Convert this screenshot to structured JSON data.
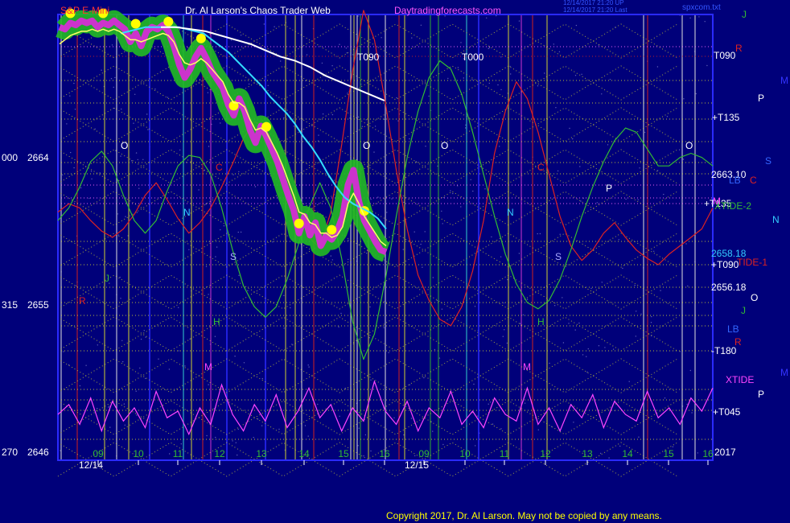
{
  "header": {
    "instrument": "S&P E-Mini",
    "author": "Dr. Al Larson's Chaos Trader Web",
    "site": "Daytradingforecasts.com",
    "stamp_line1": "12/14/2017 21:20 UP",
    "stamp_line2": "12/14/2017 21:20 Last",
    "file": "spxcom.txt"
  },
  "footer": {
    "copyright": "Copyright 2017, Dr. Al Larson. May not be copied by any means."
  },
  "colors": {
    "background": "#00007a",
    "plot_border": "#2a2aff",
    "price_bar_body": "#cc33cc",
    "price_bar_glow": "#22bb22",
    "marker_yellow": "#ffff00",
    "avg_yellow": "#ffff66",
    "avg_cyan": "#33ddff",
    "avg_white": "#ffffff",
    "red_line": "#dd2222",
    "green_line": "#33bb33",
    "magenta_line": "#ff44ff",
    "dotted_yellow": "#cccc33",
    "dotted_pink": "#ff66ff",
    "vline_red": "#cc2222",
    "vline_white": "#dddddd",
    "vline_cyan": "#33cccc",
    "vline_yellow": "#cccc33",
    "vline_magenta": "#cc33cc",
    "vline_green": "#33aa33"
  },
  "chart_data": {
    "type": "line",
    "title": "S&P E-Mini",
    "left_axis_labels": [
      {
        "value": 2664,
        "prefix": "000",
        "label": "2664"
      },
      {
        "value": 2655,
        "prefix": "315",
        "label": "2655"
      },
      {
        "value": 2646,
        "prefix": "270",
        "label": "2646"
      }
    ],
    "x_tick_labels": [
      "09",
      "10",
      "11",
      "12",
      "13",
      "14",
      "15",
      "16",
      "09",
      "10",
      "11",
      "12",
      "13",
      "14",
      "15",
      "16"
    ],
    "date_labels": [
      "12/14",
      "12/15"
    ],
    "right_axis_labels": [
      {
        "text": "T090",
        "color": "#ffffff"
      },
      {
        "text": "+T135",
        "color": "#ffffff"
      },
      {
        "text": "2663.10",
        "color": "#ffffff"
      },
      {
        "text": "+T135",
        "color": "#ffffff"
      },
      {
        "text": "2658.18",
        "color": "#33ccff"
      },
      {
        "text": "+T090",
        "color": "#ffffff"
      },
      {
        "text": "2656.18",
        "color": "#ffffff"
      },
      {
        "text": "-T180",
        "color": "#ffffff"
      },
      {
        "text": "+T045",
        "color": "#ffffff"
      },
      {
        "text": "2017",
        "color": "#ffffff"
      }
    ],
    "side_letters": [
      {
        "text": "J",
        "color": "#33bb33"
      },
      {
        "text": "R",
        "color": "#dd2222"
      },
      {
        "text": "M",
        "color": "#3333ff"
      },
      {
        "text": "P",
        "color": "#ffffff"
      },
      {
        "text": "S",
        "color": "#3366ff"
      },
      {
        "text": "LB",
        "color": "#3366ff"
      },
      {
        "text": "C",
        "color": "#dd2222"
      },
      {
        "text": "XTIDE-2",
        "color": "#33bb33"
      },
      {
        "text": "M",
        "color": "#ff44ff"
      },
      {
        "text": "N",
        "color": "#33ccff"
      },
      {
        "text": "TIDE-1",
        "color": "#dd2222"
      },
      {
        "text": "O",
        "color": "#ffffff"
      },
      {
        "text": "J",
        "color": "#33bb33"
      },
      {
        "text": "LB",
        "color": "#3366ff"
      },
      {
        "text": "R",
        "color": "#dd2222"
      },
      {
        "text": "M",
        "color": "#3333ff"
      },
      {
        "text": "XTIDE",
        "color": "#ff44ff"
      },
      {
        "text": "P",
        "color": "#ffffff"
      }
    ],
    "inner_labels": [
      {
        "text": "T090",
        "color": "#ffffff"
      },
      {
        "text": "T000",
        "color": "#ffffff"
      },
      {
        "text": "O",
        "color": "#ffffff"
      },
      {
        "text": "O",
        "color": "#ffffff"
      },
      {
        "text": "O",
        "color": "#ffffff"
      },
      {
        "text": "O",
        "color": "#ffffff"
      },
      {
        "text": "N",
        "color": "#33ccff"
      },
      {
        "text": "N",
        "color": "#33ccff"
      },
      {
        "text": "S",
        "color": "#aaaaff"
      },
      {
        "text": "S",
        "color": "#aaaaff"
      },
      {
        "text": "H",
        "color": "#33bb33"
      },
      {
        "text": "H",
        "color": "#33bb33"
      },
      {
        "text": "M",
        "color": "#ff44ff"
      },
      {
        "text": "M",
        "color": "#ff44ff"
      },
      {
        "text": "P",
        "color": "#ffffff"
      },
      {
        "text": "C",
        "color": "#dd2222"
      },
      {
        "text": "R",
        "color": "#dd2222"
      },
      {
        "text": "J",
        "color": "#33bb33"
      },
      {
        "text": "C",
        "color": "#dd2222"
      }
    ],
    "price_series": [
      2666.6,
      2666.5,
      2666.8,
      2666.7,
      2666.9,
      2666.8,
      2666.9,
      2666.6,
      2666.8,
      2666.7,
      2666.9,
      2666.7,
      2666.5,
      2665.9,
      2666.3,
      2665.7,
      2666.4,
      2666.6,
      2666.5,
      2666.7,
      2666.4,
      2665.7,
      2664.8,
      2664.2,
      2664.6,
      2665.2,
      2665.6,
      2665.1,
      2664.5,
      2664.1,
      2663.7,
      2662.9,
      2662.4,
      2663.2,
      2662.6,
      2661.7,
      2661.1,
      2661.9,
      2661.4,
      2660.8,
      2660.2,
      2659.4,
      2658.6,
      2657.9,
      2656.8,
      2657.6,
      2656.7,
      2657.3,
      2656.2,
      2656.7,
      2656.5,
      2656.9,
      2657.6,
      2659.1,
      2659.8,
      2658.3,
      2657.4,
      2656.9,
      2656.4,
      2656.0,
      2655.9
    ],
    "avg_yellow": [
      2665.8,
      2666.0,
      2666.2,
      2666.3,
      2666.4,
      2666.4,
      2666.5,
      2666.4,
      2666.5,
      2666.4,
      2666.5,
      2666.4,
      2666.2,
      2666.0,
      2666.0,
      2665.9,
      2666.0,
      2666.1,
      2666.2,
      2666.3,
      2666.2,
      2665.9,
      2665.3,
      2664.9,
      2664.8,
      2664.9,
      2665.1,
      2664.9,
      2664.6,
      2664.3,
      2664.0,
      2663.4,
      2663.0,
      2663.0,
      2662.8,
      2662.2,
      2661.7,
      2661.8,
      2661.6,
      2661.1,
      2660.6,
      2660.0,
      2659.3,
      2658.6,
      2657.8,
      2657.7,
      2657.3,
      2657.2,
      2656.8,
      2656.8,
      2656.6,
      2656.7,
      2657.1,
      2658.2,
      2658.7,
      2658.2,
      2657.6,
      2657.2,
      2656.8,
      2656.4,
      2656.2
    ],
    "avg_cyan": [
      2666.3,
      2666.4,
      2666.5,
      2666.6,
      2666.6,
      2666.6,
      2666.6,
      2666.6,
      2666.5,
      2666.4,
      2666.3,
      2666.0,
      2665.7,
      2665.4,
      2665.0,
      2664.6,
      2664.2,
      2663.8,
      2663.3,
      2662.9,
      2662.5,
      2662.0,
      2661.4,
      2660.9,
      2660.3,
      2659.6,
      2659.0,
      2658.5,
      2658.2,
      2658.0,
      2657.8,
      2657.5,
      2657.0
    ],
    "avg_white": [
      2666.6,
      2666.6,
      2666.5,
      2666.4,
      2666.2,
      2666.0,
      2665.8,
      2665.5,
      2665.2,
      2665.0,
      2664.7,
      2664.3,
      2664.0,
      2663.7,
      2663.4,
      2663.1
    ],
    "red_series": [
      2657.8,
      2658.2,
      2658.0,
      2657.4,
      2656.9,
      2656.6,
      2657.0,
      2657.7,
      2658.6,
      2659.2,
      2658.4,
      2657.5,
      2656.8,
      2657.3,
      2658.0,
      2659.0,
      2660.1,
      2661.3,
      2662.1,
      2661.9,
      2660.6,
      2659.2,
      2657.8,
      2656.6,
      2656.1,
      2657.8,
      2661.0,
      2664.5,
      2667.4,
      2666.0,
      2663.0,
      2659.8,
      2657.0,
      2654.8,
      2653.6,
      2652.7,
      2652.4,
      2653.3,
      2655.0,
      2657.4,
      2660.6,
      2662.6,
      2664.0,
      2663.2,
      2661.6,
      2659.6,
      2657.6,
      2656.2,
      2655.5,
      2656.0,
      2656.8,
      2657.3,
      2656.6,
      2656.0,
      2655.6,
      2655.3,
      2655.8,
      2656.2,
      2656.6,
      2657.0,
      2658.0
    ],
    "green_series": [
      2657.4,
      2658.0,
      2659.0,
      2660.2,
      2660.7,
      2660.0,
      2658.6,
      2657.4,
      2656.8,
      2657.4,
      2658.8,
      2660.0,
      2660.5,
      2660.4,
      2659.6,
      2658.0,
      2656.0,
      2654.3,
      2653.3,
      2652.8,
      2653.3,
      2654.6,
      2656.2,
      2658.0,
      2659.2,
      2658.0,
      2655.6,
      2652.6,
      2650.8,
      2652.0,
      2654.6,
      2657.6,
      2660.4,
      2662.6,
      2664.2,
      2665.0,
      2664.6,
      2663.4,
      2661.6,
      2659.6,
      2657.6,
      2655.8,
      2654.4,
      2653.5,
      2653.2,
      2653.6,
      2654.6,
      2656.0,
      2657.6,
      2659.0,
      2660.2,
      2661.2,
      2661.8,
      2661.6,
      2660.8,
      2660.0,
      2660.0,
      2660.4,
      2660.6,
      2660.4,
      2660.0
    ],
    "xtide_series": [
      0.45,
      0.6,
      0.3,
      0.7,
      0.2,
      0.65,
      0.35,
      0.55,
      0.25,
      0.8,
      0.4,
      0.5,
      0.15,
      0.55,
      0.3,
      0.9,
      0.45,
      0.2,
      0.6,
      0.35,
      0.75,
      0.25,
      0.5,
      0.85,
      0.4,
      0.6,
      0.2,
      0.55,
      0.35,
      0.95,
      0.5,
      0.3,
      0.65,
      0.2,
      0.55,
      0.4,
      0.8,
      0.3,
      0.5,
      0.25,
      0.7,
      0.45,
      0.35,
      0.85,
      0.3,
      0.55,
      0.2,
      0.6,
      0.4,
      0.75,
      0.25,
      0.65,
      0.45,
      0.35,
      0.8,
      0.4,
      0.55,
      0.3,
      0.7,
      0.5,
      0.85
    ]
  }
}
